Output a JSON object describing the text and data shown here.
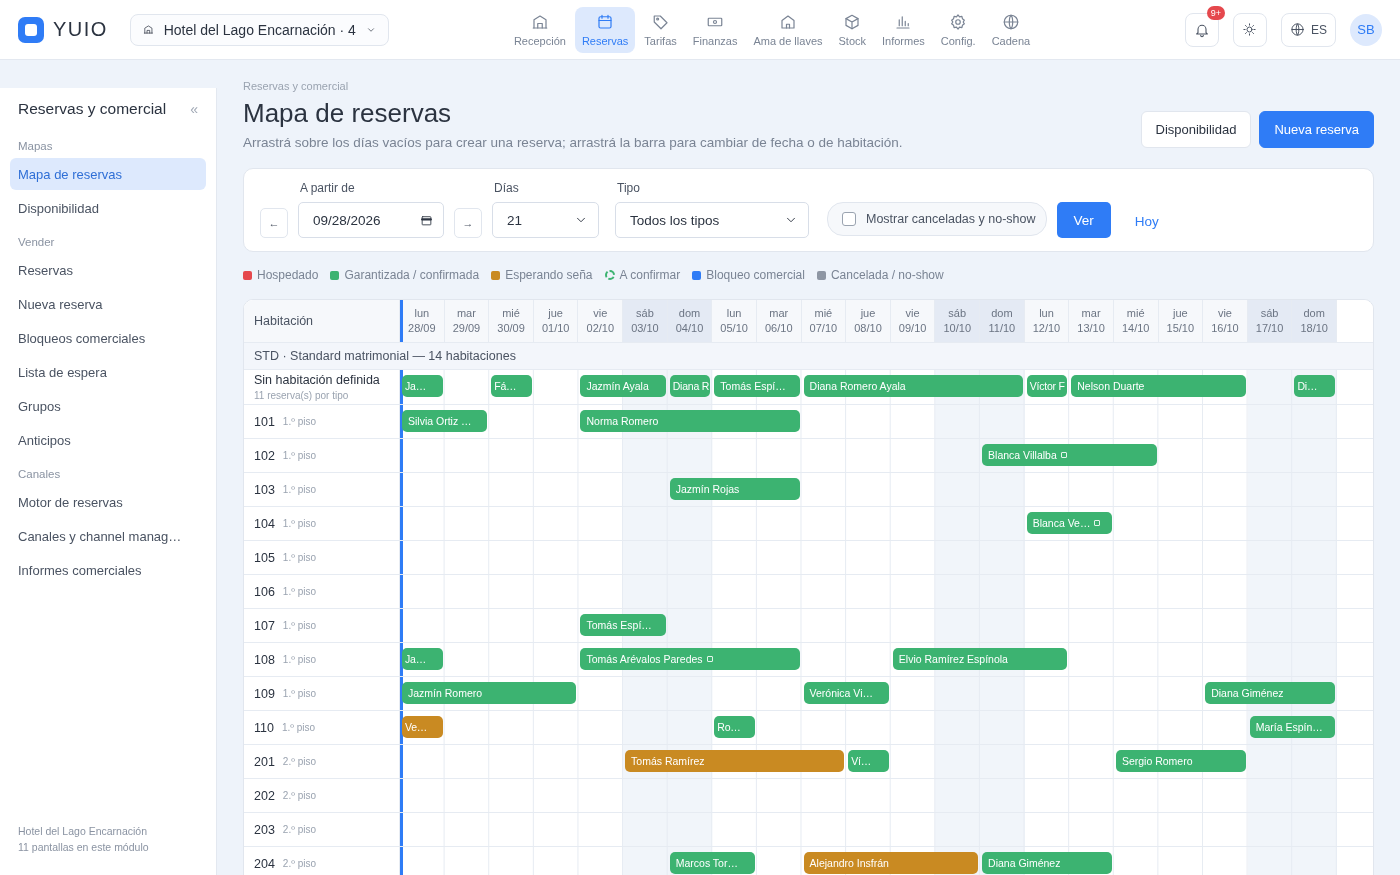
{
  "brand": {
    "name": "YUIO"
  },
  "hotel_select": {
    "value": "Hotel del Lago Encarnación · 4"
  },
  "nav": [
    {
      "label": "Recepción",
      "selected": false
    },
    {
      "label": "Reservas",
      "selected": true
    },
    {
      "label": "Tarifas",
      "selected": false
    },
    {
      "label": "Finanzas",
      "selected": false
    },
    {
      "label": "Ama de llaves",
      "selected": false
    },
    {
      "label": "Stock",
      "selected": false
    },
    {
      "label": "Informes",
      "selected": false
    },
    {
      "label": "Config.",
      "selected": false
    },
    {
      "label": "Cadena",
      "selected": false
    }
  ],
  "header_actions": {
    "notification_badge": "9+",
    "language": "ES",
    "avatar": "SB"
  },
  "sidebar": {
    "title": "Reservas y comercial",
    "collapse": "«",
    "sections": [
      {
        "label": "Mapas",
        "items": [
          {
            "label": "Mapa de reservas",
            "selected": true
          },
          {
            "label": "Disponibilidad",
            "selected": false
          }
        ]
      },
      {
        "label": "Vender",
        "items": [
          {
            "label": "Reservas",
            "selected": false
          },
          {
            "label": "Nueva reserva",
            "selected": false
          },
          {
            "label": "Bloqueos comerciales",
            "selected": false
          },
          {
            "label": "Lista de espera",
            "selected": false
          },
          {
            "label": "Grupos",
            "selected": false
          },
          {
            "label": "Anticipos",
            "selected": false
          }
        ]
      },
      {
        "label": "Canales",
        "items": [
          {
            "label": "Motor de reservas",
            "selected": false
          },
          {
            "label": "Canales y channel manag…",
            "selected": false
          },
          {
            "label": "Informes comerciales",
            "selected": false
          }
        ]
      }
    ],
    "footer": [
      "Hotel del Lago Encarnación",
      "11 pantallas en este módulo"
    ]
  },
  "page": {
    "breadcrumb": "Reservas y comercial",
    "title": "Mapa de reservas",
    "description": "Arrastrá sobre los días vacíos para crear una reserva; arrastrá la barra para cambiar de fecha o de habitación.",
    "buttons": [
      {
        "label": "Disponibilidad",
        "kind": "secondary"
      },
      {
        "label": "Nueva reserva",
        "kind": "primary"
      }
    ]
  },
  "filters": {
    "prev": "←",
    "next": "→",
    "date": {
      "label": "A partir de",
      "value": "09/28/2026"
    },
    "days": {
      "label": "Días",
      "value": "21"
    },
    "type": {
      "label": "Tipo",
      "value": "Todos los tipos"
    },
    "show_cancelled": {
      "label": "Mostrar canceladas y no-show",
      "checked": false
    },
    "apply": "Ver",
    "today": "Hoy"
  },
  "legend": [
    {
      "label": "Hospedado",
      "color": "#e5484d",
      "kind": "dot"
    },
    {
      "label": "Garantizada / confirmada",
      "color": "#3cb371",
      "kind": "dot"
    },
    {
      "label": "Esperando seña",
      "color": "#c98a22",
      "kind": "dot"
    },
    {
      "label": "A confirmar",
      "color": "#3cb371",
      "kind": "ring"
    },
    {
      "label": "Bloqueo comercial",
      "color": "#2f7cf6",
      "kind": "dot"
    },
    {
      "label": "Cancelada / no-show",
      "color": "#8e96a3",
      "kind": "dot"
    }
  ],
  "table": {
    "room_header": "Habitación",
    "days": [
      {
        "weekday": "lun",
        "date": "28/09",
        "weekend": false,
        "today": true
      },
      {
        "weekday": "mar",
        "date": "29/09",
        "weekend": false,
        "today": false
      },
      {
        "weekday": "mié",
        "date": "30/09",
        "weekend": false,
        "today": false
      },
      {
        "weekday": "jue",
        "date": "01/10",
        "weekend": false,
        "today": false
      },
      {
        "weekday": "vie",
        "date": "02/10",
        "weekend": false,
        "today": false
      },
      {
        "weekday": "sáb",
        "date": "03/10",
        "weekend": true,
        "today": false
      },
      {
        "weekday": "dom",
        "date": "04/10",
        "weekend": true,
        "today": false
      },
      {
        "weekday": "lun",
        "date": "05/10",
        "weekend": false,
        "today": false
      },
      {
        "weekday": "mar",
        "date": "06/10",
        "weekend": false,
        "today": false
      },
      {
        "weekday": "mié",
        "date": "07/10",
        "weekend": false,
        "today": false
      },
      {
        "weekday": "jue",
        "date": "08/10",
        "weekend": false,
        "today": false
      },
      {
        "weekday": "vie",
        "date": "09/10",
        "weekend": false,
        "today": false
      },
      {
        "weekday": "sáb",
        "date": "10/10",
        "weekend": true,
        "today": false
      },
      {
        "weekday": "dom",
        "date": "11/10",
        "weekend": true,
        "today": false
      },
      {
        "weekday": "lun",
        "date": "12/10",
        "weekend": false,
        "today": false
      },
      {
        "weekday": "mar",
        "date": "13/10",
        "weekend": false,
        "today": false
      },
      {
        "weekday": "mié",
        "date": "14/10",
        "weekend": false,
        "today": false
      },
      {
        "weekday": "jue",
        "date": "15/10",
        "weekend": false,
        "today": false
      },
      {
        "weekday": "vie",
        "date": "16/10",
        "weekend": false,
        "today": false
      },
      {
        "weekday": "sáb",
        "date": "17/10",
        "weekend": true,
        "today": false
      },
      {
        "weekday": "dom",
        "date": "18/10",
        "weekend": true,
        "today": false
      }
    ],
    "group": "STD · Standard matrimonial — 14 habitaciones",
    "rows": [
      {
        "room": "Sin habitación definida",
        "note": "11 reserva(s) por tipo",
        "kind": "unassigned",
        "cells": [
          {
            "kind": "in"
          },
          {
            "kind": "free"
          },
          {
            "kind": "in"
          },
          {
            "kind": "free"
          },
          {
            "kind": "in"
          },
          {
            "kind": "stay"
          },
          {
            "kind": "in"
          },
          {
            "kind": "in"
          },
          {
            "kind": "stay"
          },
          {
            "kind": "in"
          },
          {
            "kind": "stay"
          },
          {
            "kind": "stay"
          },
          {
            "kind": "stay"
          },
          {
            "kind": "stay"
          },
          {
            "kind": "in"
          },
          {
            "kind": "in"
          },
          {
            "kind": "stay"
          },
          {
            "kind": "stay"
          },
          {
            "kind": "stay"
          },
          {
            "kind": "free"
          },
          {
            "kind": "in"
          }
        ],
        "bookings": [
          {
            "guest": "Ja…",
            "color": "#3cb371",
            "has_note": false
          },
          {
            "guest": "Fá…",
            "color": "#3cb371",
            "has_note": false
          },
          {
            "guest": "Jazmín Ayala",
            "color": "#3cb371",
            "has_note": false
          },
          {
            "guest": "Diana R",
            "color": "#3cb371",
            "has_note": false
          },
          {
            "guest": "Tomás Espí…",
            "color": "#3cb371",
            "has_note": false
          },
          {
            "guest": "Diana Romero Ayala",
            "color": "#3cb371",
            "has_note": false
          },
          {
            "guest": "Víctor F",
            "color": "#3cb371",
            "has_note": false
          },
          {
            "guest": "Nelson Duarte",
            "color": "#3cb371",
            "has_note": false
          },
          {
            "guest": "Di…",
            "color": "#3cb371",
            "has_note": false
          }
        ]
      },
      {
        "room": "101",
        "note": "1.º piso",
        "kind": "room",
        "cells": [
          {
            "kind": "in"
          },
          {
            "kind": "stay"
          },
          {
            "kind": "free"
          },
          {
            "kind": "free"
          },
          {
            "kind": "in"
          },
          {
            "kind": "stay"
          },
          {
            "kind": "stay"
          },
          {
            "kind": "stay"
          },
          {
            "kind": "stay"
          },
          {
            "kind": "free"
          },
          {
            "kind": "free"
          },
          {
            "kind": "free"
          },
          {
            "kind": "free"
          },
          {
            "kind": "free"
          },
          {
            "kind": "free"
          },
          {
            "kind": "free"
          },
          {
            "kind": "free"
          },
          {
            "kind": "free"
          },
          {
            "kind": "free"
          },
          {
            "kind": "free"
          },
          {
            "kind": "free"
          }
        ],
        "bookings": [
          {
            "guest": "Silvia Ortiz …",
            "color": "#3cb371",
            "has_note": false
          },
          {
            "guest": "Norma Romero",
            "color": "#3cb371",
            "has_note": false
          }
        ]
      },
      {
        "room": "102",
        "note": "1.º piso",
        "kind": "room",
        "cells": [
          {
            "kind": "free"
          },
          {
            "kind": "free"
          },
          {
            "kind": "free"
          },
          {
            "kind": "free"
          },
          {
            "kind": "free"
          },
          {
            "kind": "free"
          },
          {
            "kind": "free"
          },
          {
            "kind": "free"
          },
          {
            "kind": "free"
          },
          {
            "kind": "free"
          },
          {
            "kind": "free"
          },
          {
            "kind": "free"
          },
          {
            "kind": "free"
          },
          {
            "kind": "in"
          },
          {
            "kind": "stay"
          },
          {
            "kind": "stay"
          },
          {
            "kind": "stay"
          },
          {
            "kind": "free"
          },
          {
            "kind": "free"
          },
          {
            "kind": "free"
          },
          {
            "kind": "free"
          }
        ],
        "bookings": [
          {
            "guest": "Blanca Villalba",
            "color": "#3cb371",
            "has_note": true
          }
        ]
      },
      {
        "room": "103",
        "note": "1.º piso",
        "kind": "room",
        "cells": [
          {
            "kind": "free"
          },
          {
            "kind": "free"
          },
          {
            "kind": "free"
          },
          {
            "kind": "free"
          },
          {
            "kind": "free"
          },
          {
            "kind": "free"
          },
          {
            "kind": "in"
          },
          {
            "kind": "stay"
          },
          {
            "kind": "stay"
          },
          {
            "kind": "free"
          },
          {
            "kind": "free"
          },
          {
            "kind": "free"
          },
          {
            "kind": "free"
          },
          {
            "kind": "free"
          },
          {
            "kind": "free"
          },
          {
            "kind": "free"
          },
          {
            "kind": "free"
          },
          {
            "kind": "free"
          },
          {
            "kind": "free"
          },
          {
            "kind": "free"
          },
          {
            "kind": "free"
          }
        ],
        "bookings": [
          {
            "guest": "Jazmín Rojas",
            "color": "#3cb371",
            "has_note": false
          }
        ]
      },
      {
        "room": "104",
        "note": "1.º piso",
        "kind": "room",
        "cells": [
          {
            "kind": "free"
          },
          {
            "kind": "free"
          },
          {
            "kind": "free"
          },
          {
            "kind": "free"
          },
          {
            "kind": "free"
          },
          {
            "kind": "free"
          },
          {
            "kind": "free"
          },
          {
            "kind": "free"
          },
          {
            "kind": "free"
          },
          {
            "kind": "free"
          },
          {
            "kind": "free"
          },
          {
            "kind": "free"
          },
          {
            "kind": "free"
          },
          {
            "kind": "free"
          },
          {
            "kind": "in"
          },
          {
            "kind": "stay"
          },
          {
            "kind": "free"
          },
          {
            "kind": "free"
          },
          {
            "kind": "free"
          },
          {
            "kind": "free"
          },
          {
            "kind": "free"
          }
        ],
        "bookings": [
          {
            "guest": "Blanca Ve…",
            "color": "#3cb371",
            "has_note": true
          }
        ]
      },
      {
        "room": "105",
        "note": "1.º piso",
        "kind": "room",
        "cells": [
          {
            "kind": "free"
          },
          {
            "kind": "free"
          },
          {
            "kind": "free"
          },
          {
            "kind": "free"
          },
          {
            "kind": "free"
          },
          {
            "kind": "free"
          },
          {
            "kind": "free"
          },
          {
            "kind": "free"
          },
          {
            "kind": "free"
          },
          {
            "kind": "free"
          },
          {
            "kind": "free"
          },
          {
            "kind": "free"
          },
          {
            "kind": "free"
          },
          {
            "kind": "free"
          },
          {
            "kind": "free"
          },
          {
            "kind": "free"
          },
          {
            "kind": "free"
          },
          {
            "kind": "free"
          },
          {
            "kind": "free"
          },
          {
            "kind": "free"
          },
          {
            "kind": "free"
          }
        ]
      },
      {
        "room": "106",
        "note": "1.º piso",
        "kind": "room",
        "cells": [
          {
            "kind": "free"
          },
          {
            "kind": "free"
          },
          {
            "kind": "free"
          },
          {
            "kind": "free"
          },
          {
            "kind": "free"
          },
          {
            "kind": "free"
          },
          {
            "kind": "free"
          },
          {
            "kind": "free"
          },
          {
            "kind": "free"
          },
          {
            "kind": "free"
          },
          {
            "kind": "free"
          },
          {
            "kind": "free"
          },
          {
            "kind": "free"
          },
          {
            "kind": "free"
          },
          {
            "kind": "free"
          },
          {
            "kind": "free"
          },
          {
            "kind": "free"
          },
          {
            "kind": "free"
          },
          {
            "kind": "free"
          },
          {
            "kind": "free"
          },
          {
            "kind": "free"
          }
        ]
      },
      {
        "room": "107",
        "note": "1.º piso",
        "kind": "room",
        "cells": [
          {
            "kind": "free"
          },
          {
            "kind": "free"
          },
          {
            "kind": "free"
          },
          {
            "kind": "free"
          },
          {
            "kind": "in"
          },
          {
            "kind": "stay"
          },
          {
            "kind": "free"
          },
          {
            "kind": "free"
          },
          {
            "kind": "free"
          },
          {
            "kind": "free"
          },
          {
            "kind": "free"
          },
          {
            "kind": "free"
          },
          {
            "kind": "free"
          },
          {
            "kind": "free"
          },
          {
            "kind": "free"
          },
          {
            "kind": "free"
          },
          {
            "kind": "free"
          },
          {
            "kind": "free"
          },
          {
            "kind": "free"
          },
          {
            "kind": "free"
          },
          {
            "kind": "free"
          }
        ],
        "bookings": [
          {
            "guest": "Tomás Espí…",
            "color": "#3cb371",
            "has_note": false
          }
        ]
      },
      {
        "room": "108",
        "note": "1.º piso",
        "kind": "room",
        "cells": [
          {
            "kind": "in"
          },
          {
            "kind": "free"
          },
          {
            "kind": "free"
          },
          {
            "kind": "free"
          },
          {
            "kind": "in"
          },
          {
            "kind": "stay"
          },
          {
            "kind": "stay"
          },
          {
            "kind": "stay"
          },
          {
            "kind": "stay"
          },
          {
            "kind": "free"
          },
          {
            "kind": "free"
          },
          {
            "kind": "in"
          },
          {
            "kind": "stay"
          },
          {
            "kind": "stay"
          },
          {
            "kind": "stay"
          },
          {
            "kind": "free"
          },
          {
            "kind": "free"
          },
          {
            "kind": "free"
          },
          {
            "kind": "free"
          },
          {
            "kind": "free"
          },
          {
            "kind": "free"
          }
        ],
        "bookings": [
          {
            "guest": "Ja…",
            "color": "#3cb371",
            "has_note": false
          },
          {
            "guest": "Tomás Arévalos Paredes",
            "color": "#3cb371",
            "has_note": true
          },
          {
            "guest": "Elvio Ramírez Espínola",
            "color": "#3cb371",
            "has_note": false
          }
        ]
      },
      {
        "room": "109",
        "note": "1.º piso",
        "kind": "room",
        "cells": [
          {
            "kind": "in"
          },
          {
            "kind": "stay"
          },
          {
            "kind": "stay"
          },
          {
            "kind": "stay"
          },
          {
            "kind": "free"
          },
          {
            "kind": "free"
          },
          {
            "kind": "free"
          },
          {
            "kind": "free"
          },
          {
            "kind": "free"
          },
          {
            "kind": "in"
          },
          {
            "kind": "stay"
          },
          {
            "kind": "free"
          },
          {
            "kind": "free"
          },
          {
            "kind": "free"
          },
          {
            "kind": "free"
          },
          {
            "kind": "free"
          },
          {
            "kind": "free"
          },
          {
            "kind": "free"
          },
          {
            "kind": "in"
          },
          {
            "kind": "stay"
          },
          {
            "kind": "stay"
          }
        ],
        "bookings": [
          {
            "guest": "Jazmín Romero",
            "color": "#3cb371",
            "has_note": false
          },
          {
            "guest": "Verónica Vi…",
            "color": "#3cb371",
            "has_note": false
          },
          {
            "guest": "Diana Giménez",
            "color": "#3cb371",
            "has_note": false
          }
        ]
      },
      {
        "room": "110",
        "note": "1.º piso",
        "kind": "room",
        "cells": [
          {
            "kind": "in"
          },
          {
            "kind": "free"
          },
          {
            "kind": "free"
          },
          {
            "kind": "free"
          },
          {
            "kind": "free"
          },
          {
            "kind": "free"
          },
          {
            "kind": "free"
          },
          {
            "kind": "in"
          },
          {
            "kind": "free"
          },
          {
            "kind": "free"
          },
          {
            "kind": "free"
          },
          {
            "kind": "free"
          },
          {
            "kind": "free"
          },
          {
            "kind": "free"
          },
          {
            "kind": "free"
          },
          {
            "kind": "free"
          },
          {
            "kind": "free"
          },
          {
            "kind": "free"
          },
          {
            "kind": "free"
          },
          {
            "kind": "in"
          },
          {
            "kind": "stay"
          }
        ],
        "bookings": [
          {
            "guest": "Ve…",
            "color": "#c98a22",
            "has_note": false
          },
          {
            "guest": "Ro…",
            "color": "#3cb371",
            "has_note": false
          },
          {
            "guest": "María Espín…",
            "color": "#3cb371",
            "has_note": false
          }
        ]
      },
      {
        "room": "201",
        "note": "2.º piso",
        "kind": "room",
        "cells": [
          {
            "kind": "free"
          },
          {
            "kind": "free"
          },
          {
            "kind": "free"
          },
          {
            "kind": "free"
          },
          {
            "kind": "free"
          },
          {
            "kind": "in"
          },
          {
            "kind": "stay"
          },
          {
            "kind": "stay"
          },
          {
            "kind": "stay"
          },
          {
            "kind": "stay"
          },
          {
            "kind": "in"
          },
          {
            "kind": "free"
          },
          {
            "kind": "free"
          },
          {
            "kind": "free"
          },
          {
            "kind": "free"
          },
          {
            "kind": "free"
          },
          {
            "kind": "in"
          },
          {
            "kind": "stay"
          },
          {
            "kind": "stay"
          },
          {
            "kind": "free"
          },
          {
            "kind": "free"
          }
        ],
        "bookings": [
          {
            "guest": "Tomás Ramírez",
            "color": "#c98a22",
            "has_note": false
          },
          {
            "guest": "Ví…",
            "color": "#3cb371",
            "has_note": false
          },
          {
            "guest": "Sergio Romero",
            "color": "#3cb371",
            "has_note": false
          }
        ]
      },
      {
        "room": "202",
        "note": "2.º piso",
        "kind": "room",
        "cells": [
          {
            "kind": "free"
          },
          {
            "kind": "free"
          },
          {
            "kind": "free"
          },
          {
            "kind": "free"
          },
          {
            "kind": "free"
          },
          {
            "kind": "free"
          },
          {
            "kind": "free"
          },
          {
            "kind": "free"
          },
          {
            "kind": "free"
          },
          {
            "kind": "free"
          },
          {
            "kind": "free"
          },
          {
            "kind": "free"
          },
          {
            "kind": "free"
          },
          {
            "kind": "free"
          },
          {
            "kind": "free"
          },
          {
            "kind": "free"
          },
          {
            "kind": "free"
          },
          {
            "kind": "free"
          },
          {
            "kind": "free"
          },
          {
            "kind": "free"
          },
          {
            "kind": "free"
          }
        ]
      },
      {
        "room": "203",
        "note": "2.º piso",
        "kind": "room",
        "cells": [
          {
            "kind": "free"
          },
          {
            "kind": "free"
          },
          {
            "kind": "free"
          },
          {
            "kind": "free"
          },
          {
            "kind": "free"
          },
          {
            "kind": "free"
          },
          {
            "kind": "free"
          },
          {
            "kind": "free"
          },
          {
            "kind": "free"
          },
          {
            "kind": "free"
          },
          {
            "kind": "free"
          },
          {
            "kind": "free"
          },
          {
            "kind": "free"
          },
          {
            "kind": "free"
          },
          {
            "kind": "free"
          },
          {
            "kind": "free"
          },
          {
            "kind": "free"
          },
          {
            "kind": "free"
          },
          {
            "kind": "free"
          },
          {
            "kind": "free"
          },
          {
            "kind": "free"
          }
        ]
      },
      {
        "room": "204",
        "note": "2.º piso",
        "kind": "room",
        "cells": [
          {
            "kind": "free"
          },
          {
            "kind": "free"
          },
          {
            "kind": "free"
          },
          {
            "kind": "free"
          },
          {
            "kind": "free"
          },
          {
            "kind": "free"
          },
          {
            "kind": "in"
          },
          {
            "kind": "stay"
          },
          {
            "kind": "free"
          },
          {
            "kind": "in"
          },
          {
            "kind": "stay"
          },
          {
            "kind": "stay"
          },
          {
            "kind": "stay"
          },
          {
            "kind": "in"
          },
          {
            "kind": "stay"
          },
          {
            "kind": "stay"
          },
          {
            "kind": "free"
          },
          {
            "kind": "free"
          },
          {
            "kind": "free"
          },
          {
            "kind": "free"
          },
          {
            "kind": "free"
          }
        ],
        "bookings": [
          {
            "guest": "Marcos Tor…",
            "color": "#3cb371",
            "has_note": false
          },
          {
            "guest": "Alejandro Insfrán",
            "color": "#c98a22",
            "has_note": false
          },
          {
            "guest": "Diana Giménez",
            "color": "#3cb371",
            "has_note": false
          }
        ]
      }
    ]
  }
}
